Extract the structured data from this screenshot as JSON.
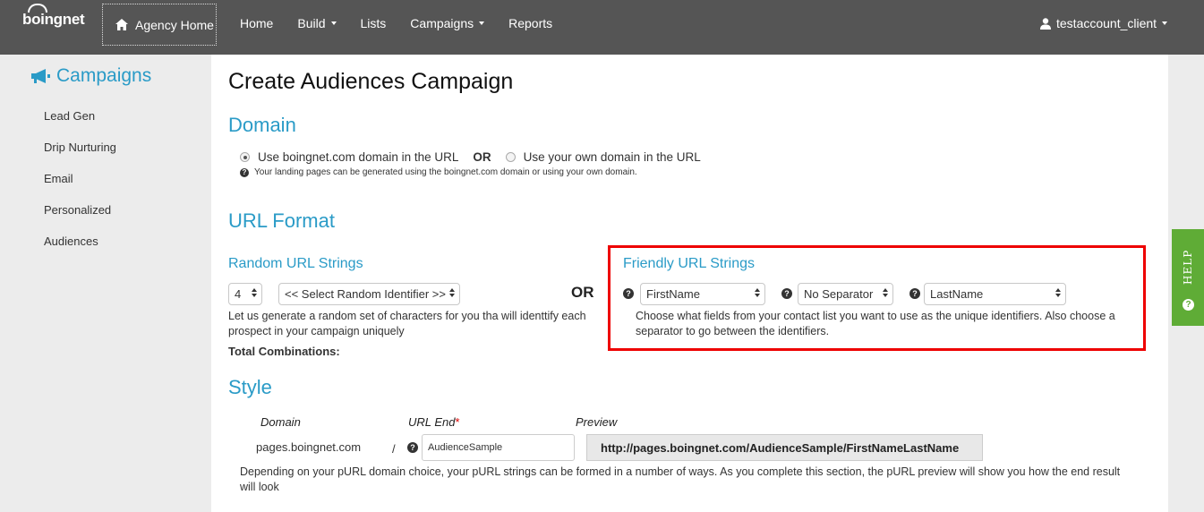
{
  "nav": {
    "logo": "boingnet",
    "agency_home": "Agency Home",
    "items": [
      {
        "label": "Home"
      },
      {
        "label": "Build"
      },
      {
        "label": "Lists"
      },
      {
        "label": "Campaigns"
      },
      {
        "label": "Reports"
      }
    ],
    "user": "testaccount_client"
  },
  "sidebar": {
    "title": "Campaigns",
    "items": [
      {
        "label": "Lead Gen"
      },
      {
        "label": "Drip Nurturing"
      },
      {
        "label": "Email"
      },
      {
        "label": "Personalized"
      },
      {
        "label": "Audiences"
      }
    ]
  },
  "main": {
    "title": "Create Audiences Campaign",
    "domain": {
      "heading": "Domain",
      "option_boingnet": "Use boingnet.com domain in the URL",
      "or": "OR",
      "option_own": "Use your own domain in the URL",
      "selected": "boingnet",
      "help": "Your landing pages can be generated using the boingnet.com domain or using your own domain."
    },
    "url_format": {
      "heading": "URL Format",
      "random": {
        "heading": "Random URL Strings",
        "count_value": "4",
        "identifier_value": "<< Select Random Identifier >>",
        "description": "Let us generate a random set of characters for you tha will identtify each prospect in your campaign uniquely",
        "total_label": "Total Combinations:"
      },
      "or": "OR",
      "friendly": {
        "heading": "Friendly URL Strings",
        "field1": "FirstName",
        "separator": "No Separator",
        "field2": "LastName",
        "description": "Choose what fields from your contact list you want to use as the unique identifiers. Also choose a separator to go between the identifiers."
      }
    },
    "style": {
      "heading": "Style",
      "domain_label": "Domain",
      "url_end_label": "URL End",
      "required_mark": "*",
      "preview_label": "Preview",
      "domain_value": "pages.boingnet.com",
      "slash": "/",
      "url_end_value": "AudienceSample",
      "preview_value": "http://pages.boingnet.com/AudienceSample/FirstNameLastName",
      "description": "Depending on your pURL domain choice, your pURL strings can be formed in a number of ways. As you complete this section, the pURL preview will show you how the end result will look"
    }
  },
  "help_tab": {
    "label": "HELP",
    "icon": "?"
  },
  "colors": {
    "accent": "#2a9bc7",
    "nav_bg": "#555555",
    "help_green": "#5fac36",
    "highlight": "#ee0000"
  }
}
